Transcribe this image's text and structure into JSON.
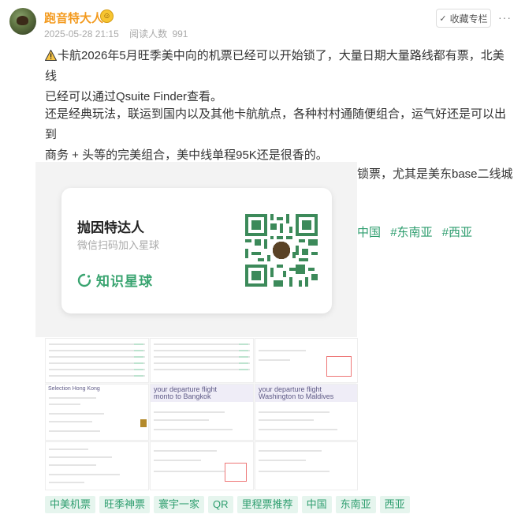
{
  "author": {
    "name": "跑音特大人",
    "emoji": "😊"
  },
  "meta": {
    "datetime": "2025-05-28 21:15",
    "read_label": "阅读人数",
    "read_count": "991"
  },
  "header": {
    "collect_label": "收藏专栏",
    "more_glyph": "···"
  },
  "post": {
    "p1_line1": "卡航2026年5月旺季美中向的机票已经可以开始锁了，大量日期大量路线都有票，北美线",
    "p1_line2": "已经可以通过Qsuite Finder查看。",
    "p2_line1": "还是经典玩法，联运到国内以及其他卡航航点，各种村村通随便组合，运气好还是可以出到",
    "p2_line2": "商务 + 头等的完美组合，美中线单程95K还是很香的。",
    "p3_visible_tail": "锁票，尤其是美东base二线城",
    "hash_tags_visible": [
      "中国",
      "#东南亚",
      "#西亚"
    ]
  },
  "overlay_card": {
    "title": "抛因特达人",
    "subtitle": "微信扫码加入星球",
    "brand": "知识星球"
  },
  "screenshots": {
    "label_bangkok": "your departure flight\nmonto to Bangkok",
    "label_maldives": "your departure flight\nWashington to Maldives",
    "label_selection": "Selection Hong Kong"
  },
  "tags": [
    "中美机票",
    "旺季神票",
    "寰宇一家",
    "QR",
    "里程票推荐",
    "中国",
    "东南亚",
    "西亚"
  ],
  "colors": {
    "accent": "#2d9d6e",
    "author": "#f39a1e"
  }
}
